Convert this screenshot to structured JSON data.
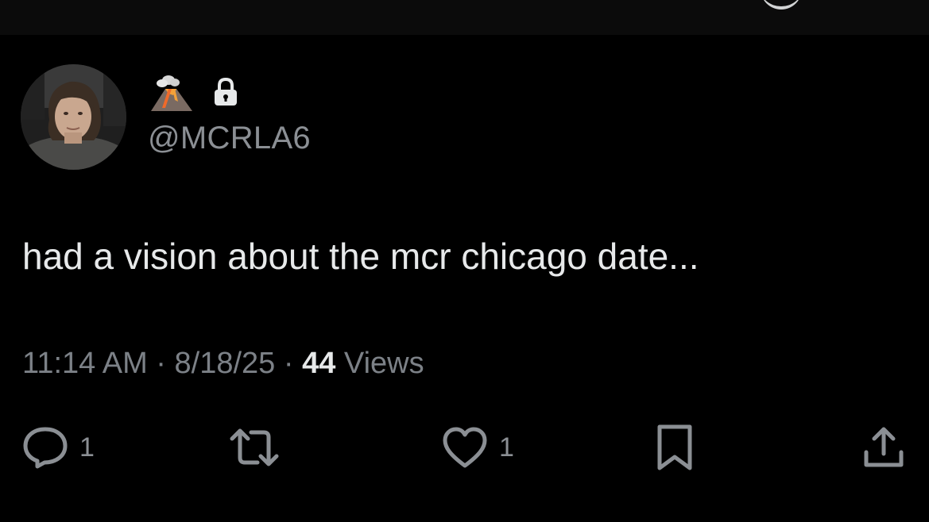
{
  "header": {
    "icon": "refresh-icon"
  },
  "tweet": {
    "avatar": "profile-photo",
    "name_emoji": "volcano",
    "protected_icon": "lock-icon",
    "handle": "@MCRLA6",
    "text": "had a vision about the mcr chicago date...",
    "time": "11:14 AM",
    "separator_1": " · ",
    "date": "8/18/25",
    "separator_2": " · ",
    "views_count": "44",
    "views_label": " Views"
  },
  "actions": {
    "reply_count": "1",
    "retweet_count": "",
    "like_count": "1",
    "icons": [
      "reply-icon",
      "retweet-icon",
      "like-icon",
      "bookmark-icon",
      "share-icon"
    ]
  },
  "colors": {
    "background": "#000000",
    "text_primary": "#e7e9ea",
    "text_secondary": "#8b8f94"
  }
}
